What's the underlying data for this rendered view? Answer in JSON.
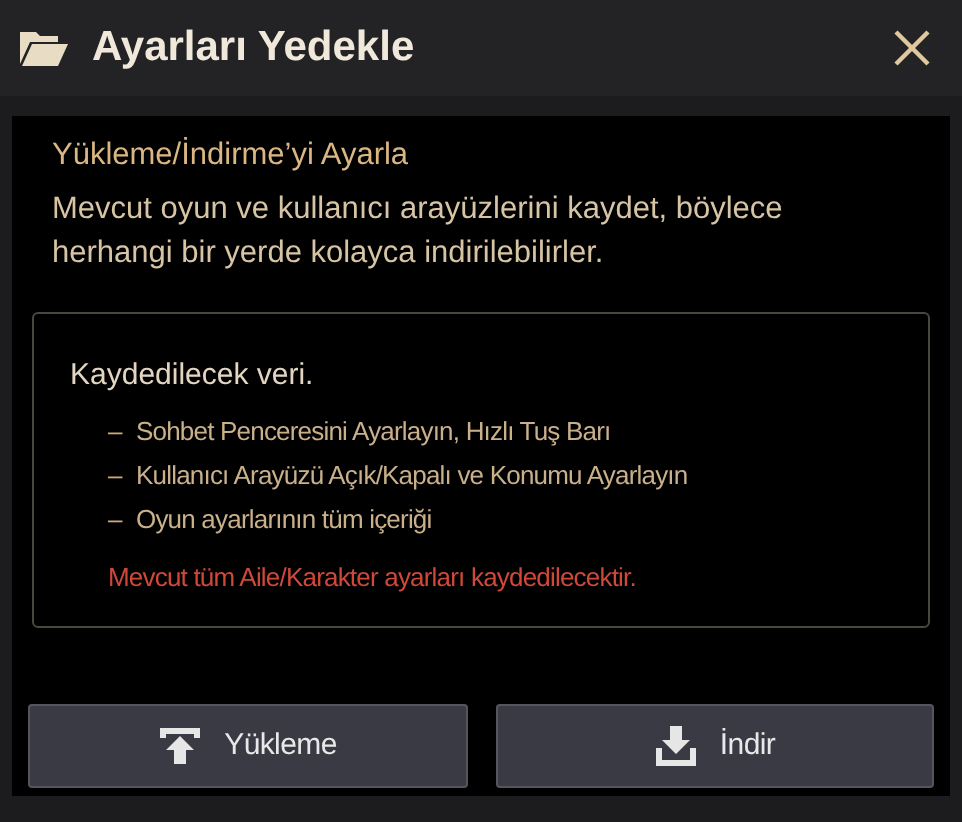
{
  "window": {
    "title": "Ayarları Yedekle"
  },
  "heading": "Yükleme/İndirme’yi Ayarla",
  "description": "Mevcut oyun ve kullanıcı arayüzlerini kaydet, böylece herhangi bir yerde kolayca indirilebilirler.",
  "info_box": {
    "title": "Kaydedilecek veri.",
    "items": [
      {
        "bullet": "–",
        "text": "Sohbet Penceresini Ayarlayın, Hızlı Tuş Barı"
      },
      {
        "bullet": "–",
        "text": "Kullanıcı Arayüzü Açık/Kapalı ve Konumu Ayarlayın"
      },
      {
        "bullet": "–",
        "text": "Oyun ayarlarının tüm içeriği"
      }
    ],
    "warning": "Mevcut tüm Aile/Karakter ayarları kaydedilecektir."
  },
  "buttons": [
    {
      "kind": "upload",
      "label": "Yükleme"
    },
    {
      "kind": "download",
      "label": "İndir"
    }
  ]
}
